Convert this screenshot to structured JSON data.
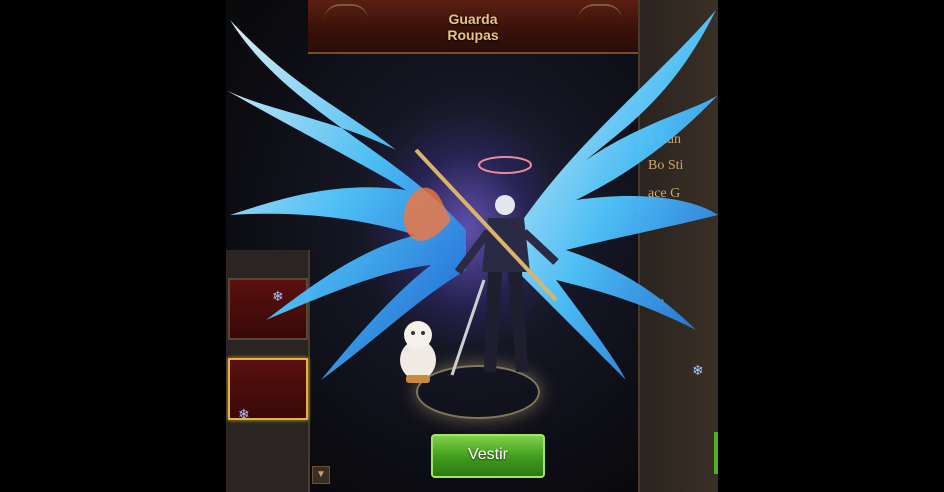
{
  "window": {
    "title_line1": "Guarda",
    "title_line2": "Roupas"
  },
  "actions": {
    "equip_label": "Vestir"
  },
  "right_panel": {
    "fragments": [
      "a Run",
      "Bo Sti",
      "ace G",
      "Cu"
    ]
  },
  "icons": {
    "snowflake": "❄",
    "scroll_down": "▼"
  },
  "colors": {
    "title_text": "#e8c77a",
    "button_green": "#4fae24",
    "wing_blue": "#4fc6ff",
    "slot_red": "#5a1010",
    "slot_selected_border": "#e0b53a"
  }
}
